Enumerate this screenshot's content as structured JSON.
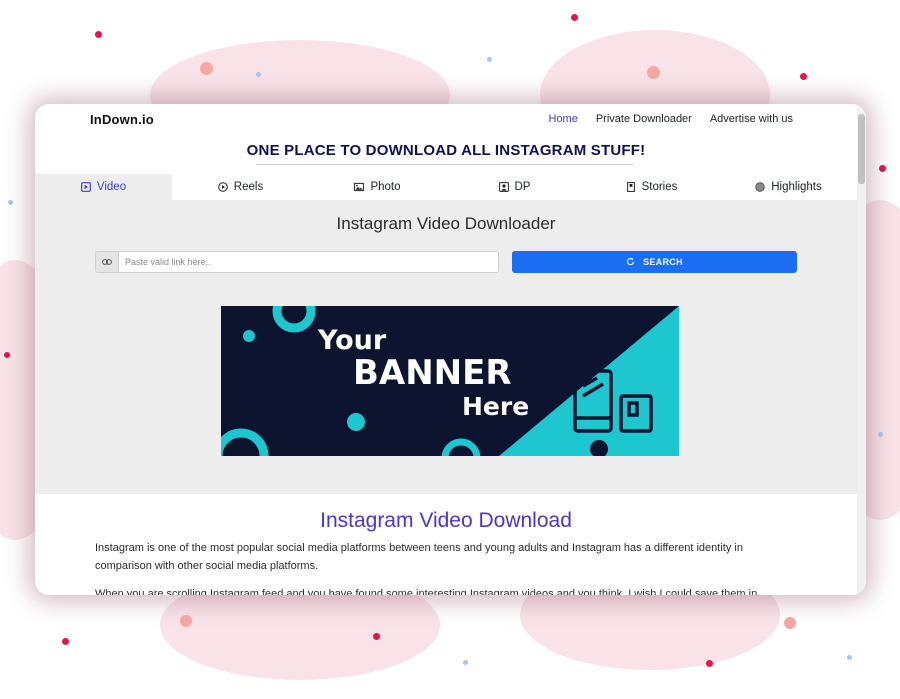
{
  "navbar": {
    "brand": "InDown.io",
    "links": [
      {
        "label": "Home",
        "active": true
      },
      {
        "label": "Private Downloader",
        "active": false
      },
      {
        "label": "Advertise with us",
        "active": false
      }
    ]
  },
  "tagline": "ONE PLACE TO DOWNLOAD ALL INSTAGRAM STUFF!",
  "tabs": [
    {
      "label": "Video",
      "icon": "play-square-icon",
      "active": true
    },
    {
      "label": "Reels",
      "icon": "play-circle-icon",
      "active": false
    },
    {
      "label": "Photo",
      "icon": "image-icon",
      "active": false
    },
    {
      "label": "DP",
      "icon": "person-square-icon",
      "active": false
    },
    {
      "label": "Stories",
      "icon": "bookmark-icon",
      "active": false
    },
    {
      "label": "Highlights",
      "icon": "circle-icon",
      "active": false
    }
  ],
  "panel": {
    "title": "Instagram Video Downloader",
    "search_placeholder": "Paste valid link here..",
    "search_value": "",
    "search_button": "SEARCH"
  },
  "banner": {
    "line1": "Your",
    "line2": "BANNER",
    "line3": "Here"
  },
  "content": {
    "title": "Instagram Video Download",
    "paragraph1": "Instagram is one of the most popular social media platforms between teens and young adults and Instagram has a different identity in comparison with other social media platforms.",
    "paragraph2": "When you are scrolling Instagram feed and you have found some interesting Instagram videos and you think, I wish I could save them in"
  },
  "colors": {
    "accent": "#3b3fc8",
    "button": "#1a6ef2",
    "heading": "#4a35d4",
    "tagline": "#0e1157",
    "banner_dark": "#0c1430",
    "banner_teal": "#1ec6cf"
  }
}
